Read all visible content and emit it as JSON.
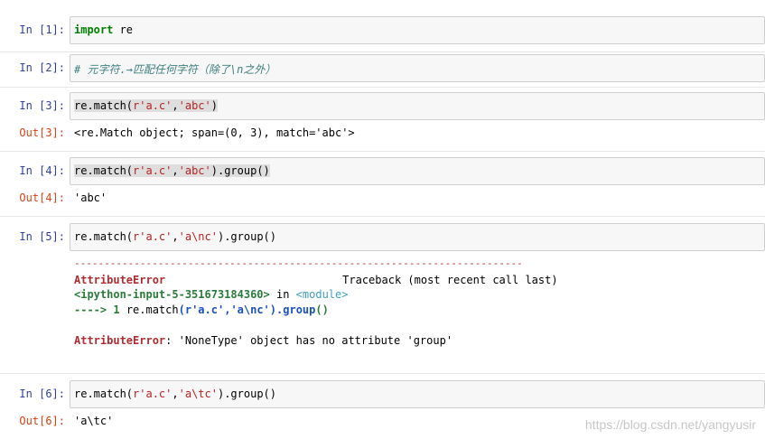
{
  "cells": [
    {
      "prompt": "In  [1]:",
      "code": {
        "kw": "import",
        "rest": " re"
      }
    },
    {
      "prompt": "In  [2]:",
      "comment": "# 元字符.→匹配任何字符（除了\\n之外）"
    },
    {
      "prompt": "In  [3]:",
      "code": {
        "pre": "re.match(",
        "s1": "r'a.c'",
        "mid": ",",
        "s2": "'abc'",
        "post": ")"
      },
      "out_prompt": "Out[3]:",
      "output": "<re.Match object; span=(0, 3), match='abc'>"
    },
    {
      "prompt": "In  [4]:",
      "code": {
        "pre": "re.match(",
        "s1": "r'a.c'",
        "mid": ",",
        "s2": "'abc'",
        "post": ").group()"
      },
      "out_prompt": "Out[4]:",
      "output": "'abc'"
    },
    {
      "prompt": "In  [5]:",
      "code": {
        "pre": "re.match(",
        "s1": "r'a.c'",
        "mid": ",",
        "s2": "'a\\nc'",
        "post": ").group()"
      },
      "error": {
        "dashes": "---------------------------------------------------------------------------",
        "type": "AttributeError",
        "traceback_label": "Traceback (most recent call last)",
        "location": "<ipython-input-5-351673184360>",
        "in_word": "in",
        "module": "<module>",
        "arrow": "----> 1",
        "line_pre": "re.match",
        "line_paren": "(",
        "line_s1": "r'a.c'",
        "line_comma": ",",
        "line_s2": "'a\\nc'",
        "line_close": ").group",
        "line_call": "()",
        "message": ": 'NoneType' object has no attribute 'group'"
      }
    },
    {
      "prompt": "In  [6]:",
      "code": {
        "pre": "re.match(",
        "s1": "r'a.c'",
        "mid": ",",
        "s2": "'a\\tc'",
        "post": ").group()"
      },
      "out_prompt": "Out[6]:",
      "output": "'a\\tc'"
    }
  ],
  "watermark": "https://blog.csdn.net/yangyusir"
}
